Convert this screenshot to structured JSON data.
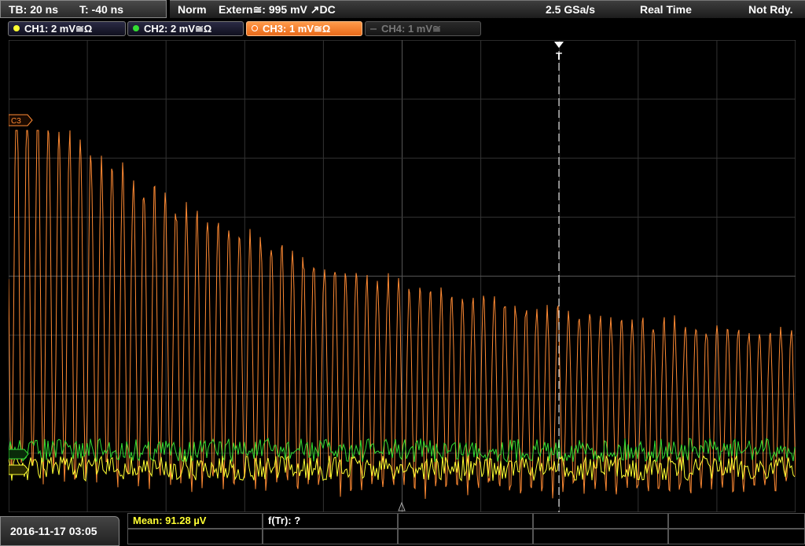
{
  "timebase": {
    "tb": "TB: 20 ns",
    "trig_offset": "T: -40 ns"
  },
  "status": {
    "mode": "Norm",
    "trigger": "Extern≅: 995 mV ↗DC",
    "sample_rate": "2.5 GSa/s",
    "acq_mode": "Real Time",
    "state": "Not Rdy."
  },
  "channels": [
    {
      "label": "CH1: 2 mV≅Ω",
      "color": "#ffff33",
      "active": true
    },
    {
      "label": "CH2: 2 mV≅Ω",
      "color": "#33dd33",
      "active": true
    },
    {
      "label": "CH3: 1 mV≅Ω",
      "color": "#ff8a33",
      "active": true,
      "selected": true
    },
    {
      "label": "CH4: 1 mV≅",
      "color": "#666666",
      "active": false
    }
  ],
  "markers": {
    "ch3": "C3",
    "trigger": "T"
  },
  "date": "2016-11-17 03:05",
  "measurements": {
    "mean": "Mean: 91.28 µV",
    "freq": "f(Tr): ?"
  },
  "colors": {
    "ch1": "#ffff33",
    "ch2": "#33dd33",
    "ch3": "#ff8a33",
    "grid": "#3a3a3a",
    "trigger_line": "#ffffff"
  }
}
